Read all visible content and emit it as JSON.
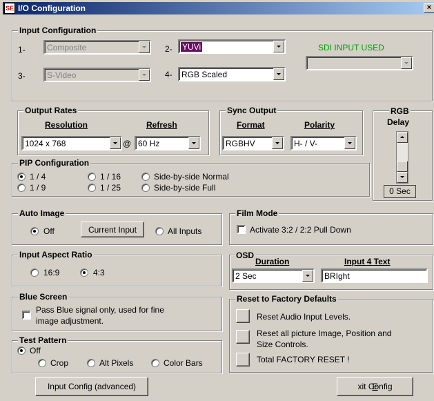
{
  "window": {
    "title": "I/O Configuration",
    "icon_text": "SE",
    "close_label": "×"
  },
  "input_config": {
    "legend": "Input Configuration",
    "slot1": {
      "num": "1-",
      "value": "Composite"
    },
    "slot2": {
      "num": "2-",
      "value": "YUVi"
    },
    "slot3": {
      "num": "3-",
      "value": "S-Video"
    },
    "slot4": {
      "num": "4-",
      "value": "RGB Scaled"
    },
    "sdi_label": "SDI INPUT USED",
    "sdi_value": ""
  },
  "output_rates": {
    "legend": "Output Rates",
    "resolution_label": "Resolution",
    "refresh_label": "Refresh",
    "resolution_value": "1024 x 768",
    "at": "@",
    "refresh_value": "60 Hz"
  },
  "sync_output": {
    "legend": "Sync Output",
    "format_label": "Format",
    "polarity_label": "Polarity",
    "format_value": "RGBHV",
    "polarity_value": "H- / V-"
  },
  "rgb_delay": {
    "label_line1": "RGB",
    "label_line2": "Delay",
    "value": "0 Sec"
  },
  "pip": {
    "legend": "PIP Configuration",
    "options": [
      "1 / 4",
      "1 / 16",
      "Side-by-side Normal",
      "1 / 9",
      "1 / 25",
      "Side-by-side Full"
    ],
    "selected": "1 / 4"
  },
  "auto_image": {
    "legend": "Auto Image",
    "off_label": "Off",
    "current_input_label": "Current Input",
    "all_inputs_label": "All Inputs",
    "selected": "Off"
  },
  "film_mode": {
    "legend": "Film Mode",
    "checkbox_label": "Activate 3:2 / 2:2 Pull Down"
  },
  "aspect": {
    "legend": "Input Aspect Ratio",
    "opt1": "16:9",
    "opt2": "4:3",
    "selected": "4:3"
  },
  "osd": {
    "legend": "OSD",
    "duration_label": "Duration",
    "input4_label": "Input 4 Text",
    "duration_value": "2 Sec",
    "input4_value": "BRIght"
  },
  "blue_screen": {
    "legend": "Blue Screen",
    "line1": "Pass Blue signal only, used for fine",
    "line2": "image adjustment."
  },
  "reset": {
    "legend": "Reset to Factory Defaults",
    "audio_label": "Reset Audio Input Levels.",
    "picture_line1": "Reset all picture Image, Position and",
    "picture_line2": "Size Controls.",
    "factory_label": "Total FACTORY RESET !"
  },
  "test_pattern": {
    "legend": "Test Pattern",
    "off_label": "Off",
    "crop_label": "Crop",
    "alt_label": "Alt Pixels",
    "bars_label": "Color Bars",
    "selected": "Off"
  },
  "footer": {
    "advanced_label": "Input Config (advanced)",
    "exit_label_prefix": "E",
    "exit_label_rest": "xit Config"
  }
}
